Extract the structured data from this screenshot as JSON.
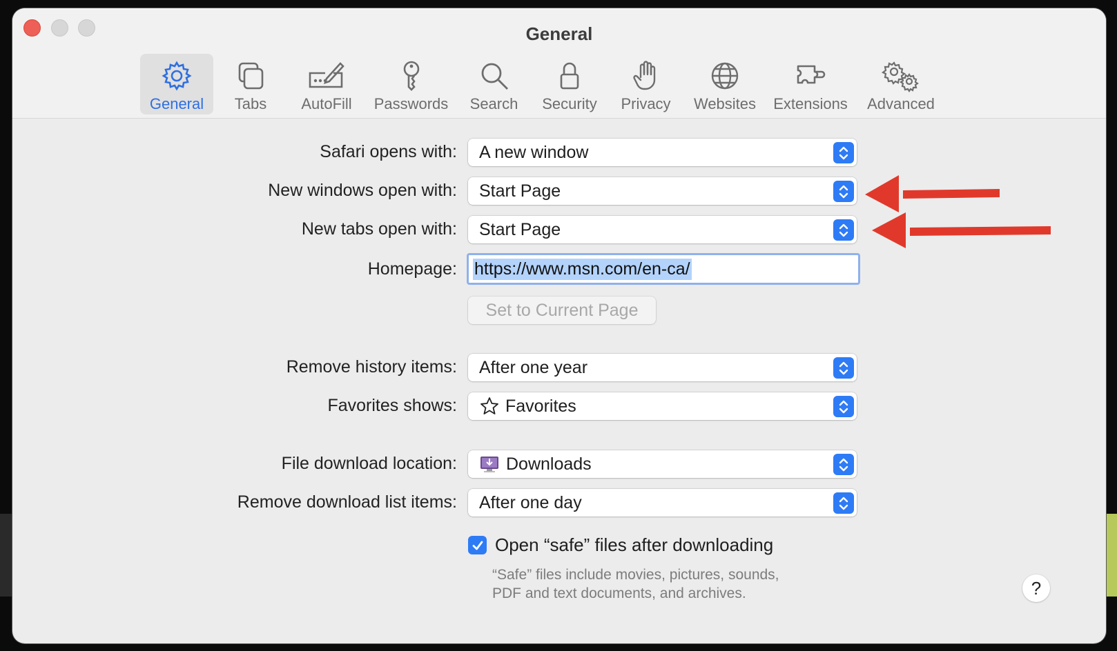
{
  "window": {
    "title": "General"
  },
  "toolbar": {
    "tabs": [
      {
        "label": "General",
        "icon": "gear-icon",
        "active": true
      },
      {
        "label": "Tabs",
        "icon": "tabs-icon",
        "active": false
      },
      {
        "label": "AutoFill",
        "icon": "pencil-field-icon",
        "active": false
      },
      {
        "label": "Passwords",
        "icon": "key-icon",
        "active": false
      },
      {
        "label": "Search",
        "icon": "magnifier-icon",
        "active": false
      },
      {
        "label": "Security",
        "icon": "lock-icon",
        "active": false
      },
      {
        "label": "Privacy",
        "icon": "hand-icon",
        "active": false
      },
      {
        "label": "Websites",
        "icon": "globe-icon",
        "active": false
      },
      {
        "label": "Extensions",
        "icon": "puzzle-icon",
        "active": false
      },
      {
        "label": "Advanced",
        "icon": "gears-icon",
        "active": false
      }
    ]
  },
  "settings": {
    "safari_opens_label": "Safari opens with:",
    "safari_opens_value": "A new window",
    "new_windows_label": "New windows open with:",
    "new_windows_value": "Start Page",
    "new_tabs_label": "New tabs open with:",
    "new_tabs_value": "Start Page",
    "homepage_label": "Homepage:",
    "homepage_value": "https://www.msn.com/en-ca/",
    "set_current_label": "Set to Current Page",
    "remove_history_label": "Remove history items:",
    "remove_history_value": "After one year",
    "favorites_shows_label": "Favorites shows:",
    "favorites_shows_value": "Favorites",
    "download_location_label": "File download location:",
    "download_location_value": "Downloads",
    "remove_download_label": "Remove download list items:",
    "remove_download_value": "After one day",
    "open_safe_label": "Open “safe” files after downloading",
    "open_safe_checked": true,
    "safe_desc_line1": "“Safe” files include movies, pictures, sounds,",
    "safe_desc_line2": "PDF and text documents, and archives.",
    "help_label": "?"
  },
  "colors": {
    "accent": "#2e7bf6",
    "annotation_arrow": "#e0392b"
  }
}
